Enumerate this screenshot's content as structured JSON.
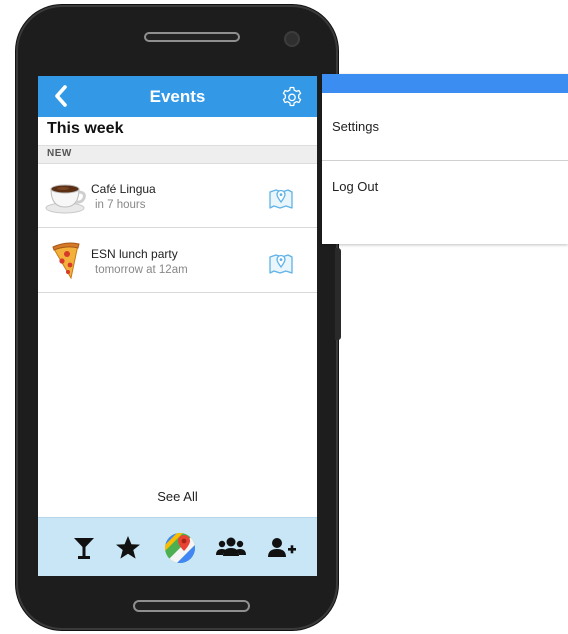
{
  "header": {
    "title": "Events",
    "back_icon": "chevron-left-icon",
    "settings_icon": "gear-icon",
    "color": "#3399e6"
  },
  "section": {
    "title": "This week",
    "group_label": "NEW"
  },
  "events": [
    {
      "name": "Café Lingua",
      "time": "in 7 hours",
      "icon": "coffee-cup-icon",
      "action_icon": "map-pin-icon"
    },
    {
      "name": "ESN lunch party",
      "time": "tomorrow at 12am",
      "icon": "pizza-slice-icon",
      "action_icon": "map-pin-icon"
    }
  ],
  "see_all_label": "See All",
  "tabbar": {
    "background": "#c9e6f7",
    "tabs": [
      {
        "icon": "cocktail-icon"
      },
      {
        "icon": "star-icon"
      },
      {
        "icon": "maps-icon"
      },
      {
        "icon": "group-icon"
      },
      {
        "icon": "add-user-icon"
      }
    ]
  },
  "menu": {
    "accent": "#3b8df2",
    "items": [
      {
        "label": "Settings"
      },
      {
        "label": "Log Out"
      }
    ]
  }
}
